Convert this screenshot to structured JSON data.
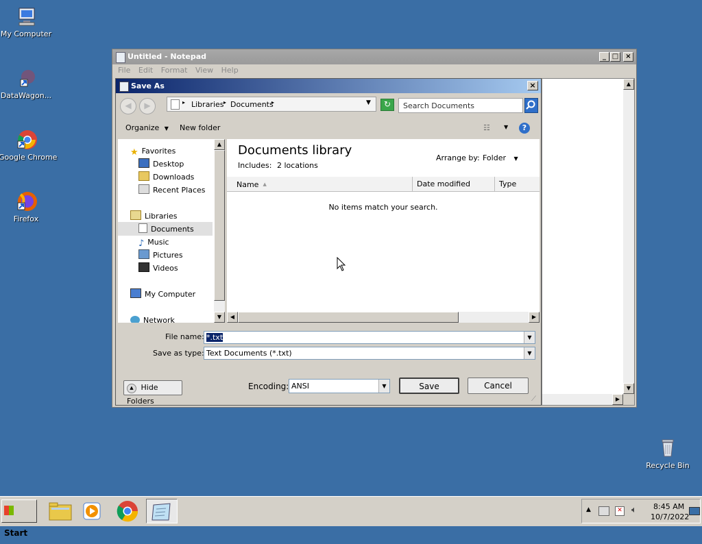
{
  "desktop": {
    "icons": [
      {
        "label": "My Computer"
      },
      {
        "label": "DataWagon..."
      },
      {
        "label": "Google Chrome"
      },
      {
        "label": "Firefox"
      },
      {
        "label": "Recycle Bin"
      }
    ]
  },
  "notepad": {
    "title": "Untitled - Notepad",
    "menu": [
      "File",
      "Edit",
      "Format",
      "View",
      "Help"
    ]
  },
  "dialog": {
    "title": "Save As",
    "breadcrumb": [
      "Libraries",
      "Documents"
    ],
    "search_placeholder": "Search Documents",
    "toolbar": {
      "organize": "Organize",
      "new_folder": "New folder"
    },
    "nav": {
      "favorites": "Favorites",
      "favorites_items": [
        "Desktop",
        "Downloads",
        "Recent Places"
      ],
      "libraries": "Libraries",
      "libraries_items": [
        "Documents",
        "Music",
        "Pictures",
        "Videos"
      ],
      "my_computer": "My Computer",
      "network": "Network"
    },
    "content": {
      "heading": "Documents library",
      "includes_label": "Includes:",
      "includes_value": "2 locations",
      "arrange_label": "Arrange by:",
      "arrange_value": "Folder",
      "columns": [
        "Name",
        "Date modified",
        "Type"
      ],
      "empty_message": "No items match your search."
    },
    "filename_label": "File name:",
    "filename_value": "*.txt",
    "savetype_label": "Save as type:",
    "savetype_value": "Text Documents (*.txt)",
    "hide_folders": "Hide Folders",
    "encoding_label": "Encoding:",
    "encoding_value": "ANSI",
    "save": "Save",
    "cancel": "Cancel"
  },
  "taskbar": {
    "start": "Start",
    "time": "8:45 AM",
    "date": "10/7/2022"
  },
  "colors": {
    "desktop": "#3a6ea5",
    "selection": "#0a246a"
  }
}
